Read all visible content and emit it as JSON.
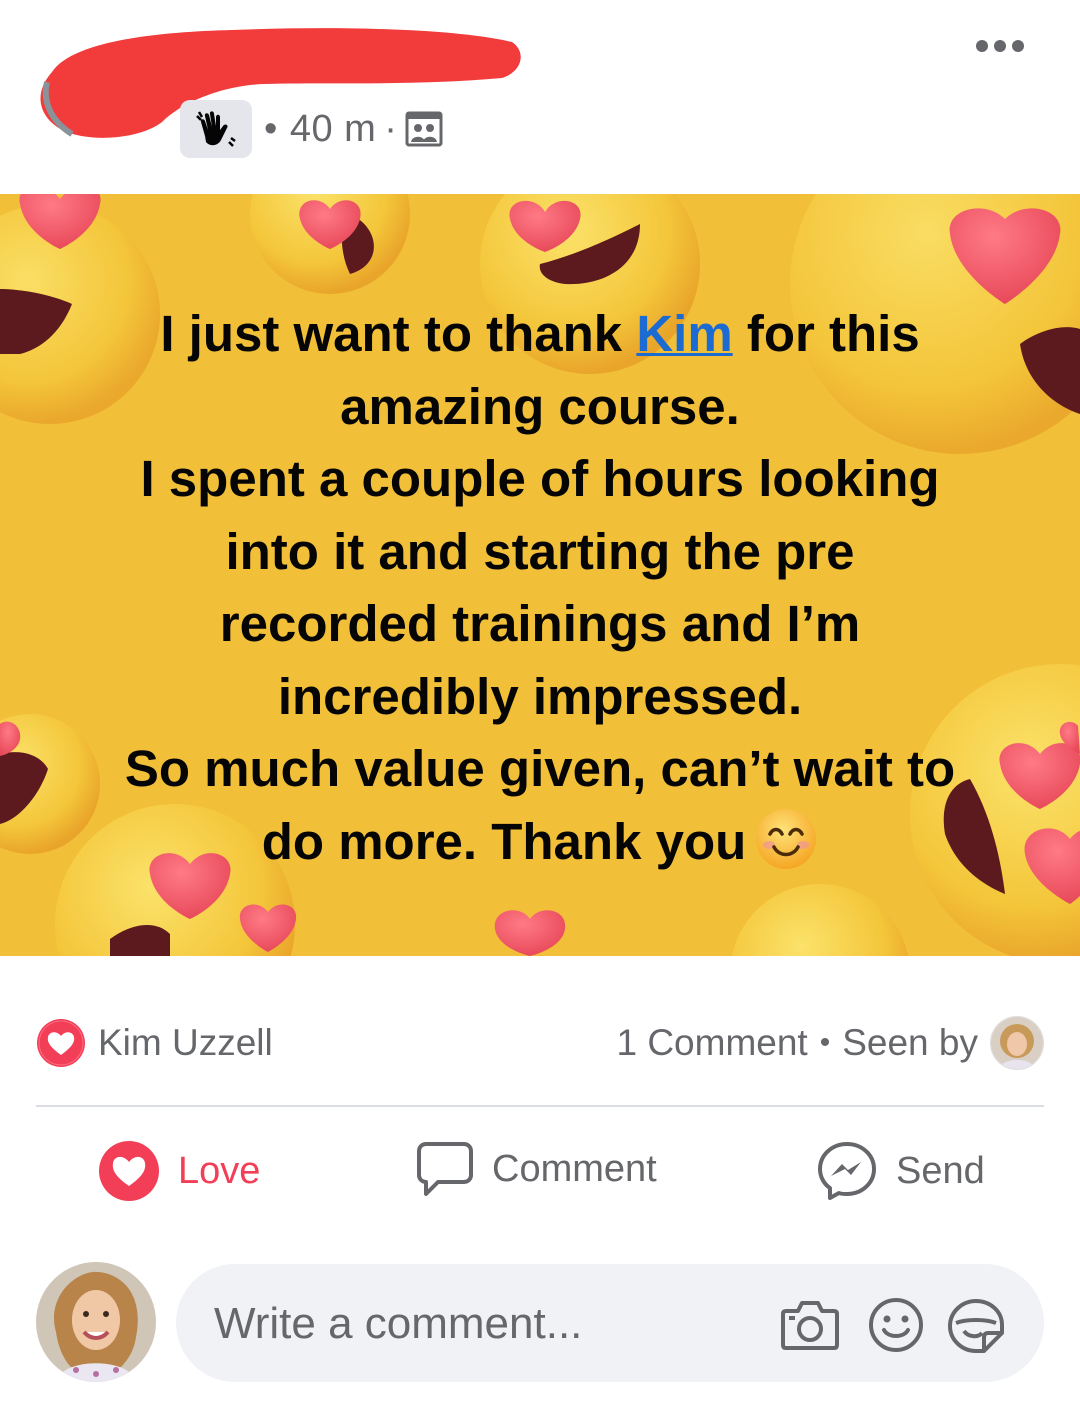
{
  "header": {
    "time": "40 m",
    "meta_dot": "•",
    "separator": "·",
    "icons": [
      "waving-hand-icon",
      "group-photo-icon",
      "more-options-icon"
    ]
  },
  "post": {
    "lines": [
      {
        "before": "I just want to thank ",
        "mention": "Kim",
        "after": " for this"
      },
      {
        "text": "amazing course."
      },
      {
        "text": "I spent a couple of hours looking"
      },
      {
        "text": "into it and starting the pre"
      },
      {
        "text": "recorded trainings and I’m"
      },
      {
        "text": "incredibly impressed."
      },
      {
        "text": "So much value given, can’t wait to"
      },
      {
        "text": "do more.  Thank you"
      }
    ],
    "emoji": "smiling-face-icon",
    "background_color": "#f2bf38"
  },
  "reactions": {
    "reactor": "Kim Uzzell",
    "comments": "1 Comment",
    "dot": "•",
    "seen_by": "Seen by"
  },
  "actions": {
    "love": "Love",
    "comment": "Comment",
    "send": "Send"
  },
  "composer": {
    "placeholder": "Write a comment..."
  },
  "colors": {
    "love": "#f33e58",
    "mention": "#1b6bd2",
    "meta": "#65676b",
    "redaction": "#f23b3b"
  }
}
